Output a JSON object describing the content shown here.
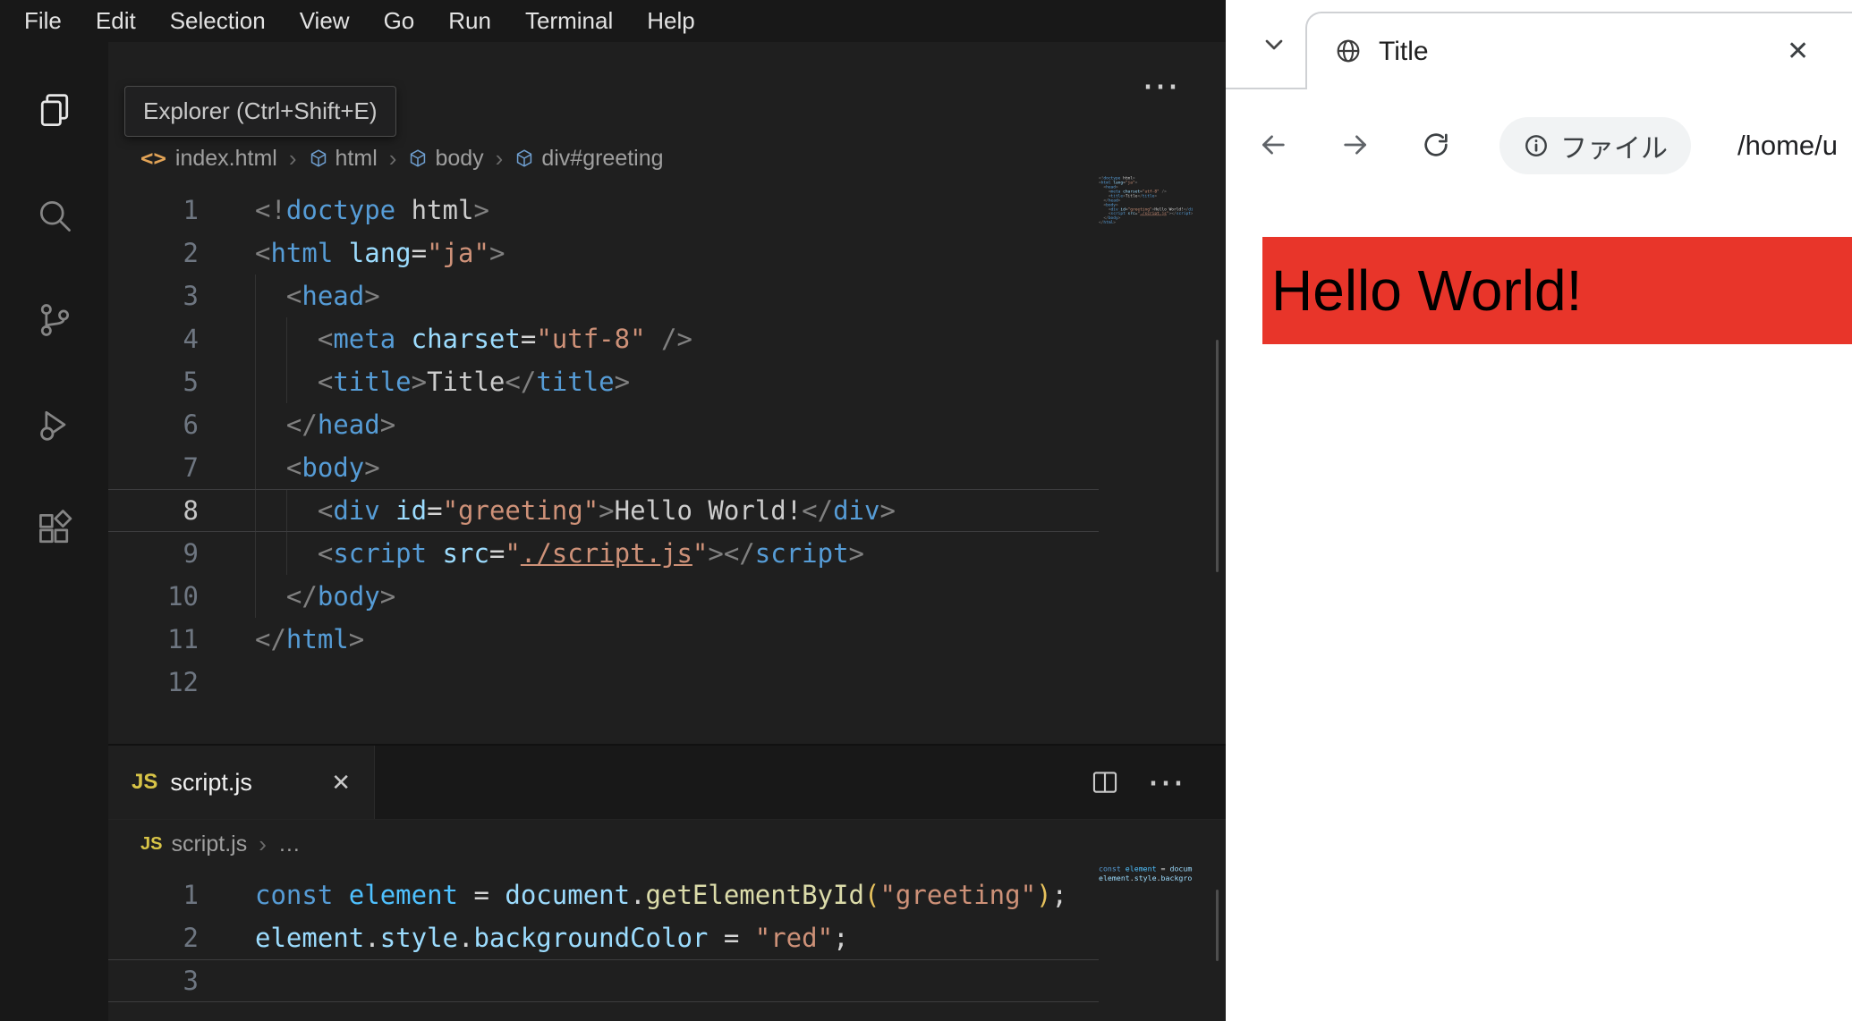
{
  "icons": {
    "more": "⋯",
    "close": "✕",
    "crumb_sep": "›",
    "code_icon": "<>",
    "js_badge": "JS"
  },
  "vscode": {
    "menu": [
      "File",
      "Edit",
      "Selection",
      "View",
      "Go",
      "Run",
      "Terminal",
      "Help"
    ],
    "tooltip": "Explorer (Ctrl+Shift+E)",
    "activity_bar": [
      "explorer",
      "search",
      "source-control",
      "run-and-debug",
      "extensions"
    ],
    "html_editor": {
      "breadcrumb": [
        "index.html",
        "html",
        "body",
        "div#greeting"
      ],
      "active_line": 8,
      "lines": [
        [
          [
            "pu",
            "<!"
          ],
          [
            "tg",
            "doctype"
          ],
          [
            "tx",
            " html"
          ],
          [
            "pu",
            ">"
          ]
        ],
        [
          [
            "pu",
            "<"
          ],
          [
            "tg",
            "html"
          ],
          [
            "at",
            " lang"
          ],
          [
            "op",
            "="
          ],
          [
            "st",
            "\"ja\""
          ],
          [
            "pu",
            ">"
          ]
        ],
        [
          [
            "tx",
            "  "
          ],
          [
            "pu",
            "<"
          ],
          [
            "tg",
            "head"
          ],
          [
            "pu",
            ">"
          ]
        ],
        [
          [
            "tx",
            "    "
          ],
          [
            "pu",
            "<"
          ],
          [
            "tg",
            "meta"
          ],
          [
            "at",
            " charset"
          ],
          [
            "op",
            "="
          ],
          [
            "st",
            "\"utf-8\""
          ],
          [
            "tx",
            " "
          ],
          [
            "pu",
            "/>"
          ]
        ],
        [
          [
            "tx",
            "    "
          ],
          [
            "pu",
            "<"
          ],
          [
            "tg",
            "title"
          ],
          [
            "pu",
            ">"
          ],
          [
            "tx",
            "Title"
          ],
          [
            "pu",
            "</"
          ],
          [
            "tg",
            "title"
          ],
          [
            "pu",
            ">"
          ]
        ],
        [
          [
            "tx",
            "  "
          ],
          [
            "pu",
            "</"
          ],
          [
            "tg",
            "head"
          ],
          [
            "pu",
            ">"
          ]
        ],
        [
          [
            "tx",
            "  "
          ],
          [
            "pu",
            "<"
          ],
          [
            "tg",
            "body"
          ],
          [
            "pu",
            ">"
          ]
        ],
        [
          [
            "tx",
            "    "
          ],
          [
            "pu",
            "<"
          ],
          [
            "tg",
            "div"
          ],
          [
            "at",
            " id"
          ],
          [
            "op",
            "="
          ],
          [
            "st",
            "\"greeting\""
          ],
          [
            "pu",
            ">"
          ],
          [
            "tx",
            "Hello World!"
          ],
          [
            "pu",
            "</"
          ],
          [
            "tg",
            "div"
          ],
          [
            "pu",
            ">"
          ]
        ],
        [
          [
            "tx",
            "    "
          ],
          [
            "pu",
            "<"
          ],
          [
            "tg",
            "script"
          ],
          [
            "at",
            " src"
          ],
          [
            "op",
            "="
          ],
          [
            "st",
            "\""
          ],
          [
            "lk",
            "./script.js"
          ],
          [
            "st",
            "\""
          ],
          [
            "pu",
            "></"
          ],
          [
            "tg",
            "script"
          ],
          [
            "pu",
            ">"
          ]
        ],
        [
          [
            "tx",
            "  "
          ],
          [
            "pu",
            "</"
          ],
          [
            "tg",
            "body"
          ],
          [
            "pu",
            ">"
          ]
        ],
        [
          [
            "pu",
            "</"
          ],
          [
            "tg",
            "html"
          ],
          [
            "pu",
            ">"
          ]
        ],
        []
      ]
    },
    "js_editor": {
      "tab": "script.js",
      "breadcrumb": [
        "script.js",
        "…"
      ],
      "active_line": 3,
      "lines": [
        [
          [
            "kw",
            "const"
          ],
          [
            "vr",
            " element"
          ],
          [
            "op",
            " = "
          ],
          [
            "ob",
            "document"
          ],
          [
            "op",
            "."
          ],
          [
            "fn",
            "getElementById"
          ],
          [
            "pr",
            "("
          ],
          [
            "st",
            "\"greeting\""
          ],
          [
            "pr",
            ")"
          ],
          [
            "op",
            ";"
          ]
        ],
        [
          [
            "ob",
            "element"
          ],
          [
            "op",
            "."
          ],
          [
            "ob",
            "style"
          ],
          [
            "op",
            "."
          ],
          [
            "ob",
            "backgroundColor"
          ],
          [
            "op",
            " = "
          ],
          [
            "st",
            "\"red\""
          ],
          [
            "op",
            ";"
          ]
        ],
        []
      ]
    }
  },
  "browser": {
    "tab_title": "Title",
    "nav": {
      "chip_label": "ファイル",
      "url": "/home/u"
    },
    "page": {
      "text": "Hello World!",
      "bg": "#e8352a",
      "text_color": "#000000"
    }
  }
}
